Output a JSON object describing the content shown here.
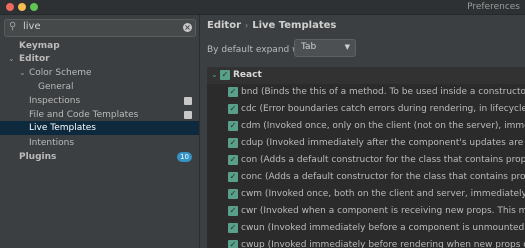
{
  "window": {
    "title": "Preferences"
  },
  "search": {
    "value": "live"
  },
  "sidebar": {
    "items": [
      {
        "label": "Keymap",
        "bold": true
      },
      {
        "label": "Editor",
        "bold": true
      },
      {
        "label": "Color Scheme"
      },
      {
        "label": "General"
      },
      {
        "label": "Inspections"
      },
      {
        "label": "File and Code Templates"
      },
      {
        "label": "Live Templates",
        "selected": true
      },
      {
        "label": "Intentions"
      },
      {
        "label": "Plugins",
        "bold": true,
        "badge": "10"
      }
    ]
  },
  "breadcrumb": {
    "root": "Editor",
    "current": "Live Templates"
  },
  "expand": {
    "label": "By default expand with",
    "value": "Tab"
  },
  "templates": {
    "group": "React",
    "rows": [
      "bnd (Binds the this of a method. To be used inside a constructor)",
      "cdc (Error boundaries catch errors during rendering, in lifecycle methods, and",
      "cdm (Invoked once, only on the client (not on the server), immediately after th",
      "cdup (Invoked immediately after the component's updates are flushed to the",
      "con (Adds a default constructor for the class that contains props as argumen",
      "conc (Adds a default constructor for the class that contains props and conte",
      "cwm (Invoked once, both on the client and server, immediately before the initi",
      "cwr (Invoked when a component is receiving new props. This method is not c",
      "cwun (Invoked immediately before a component is unmounted from the DOM.",
      "cwup (Invoked immediately before rendering when new props or state are be"
    ]
  }
}
